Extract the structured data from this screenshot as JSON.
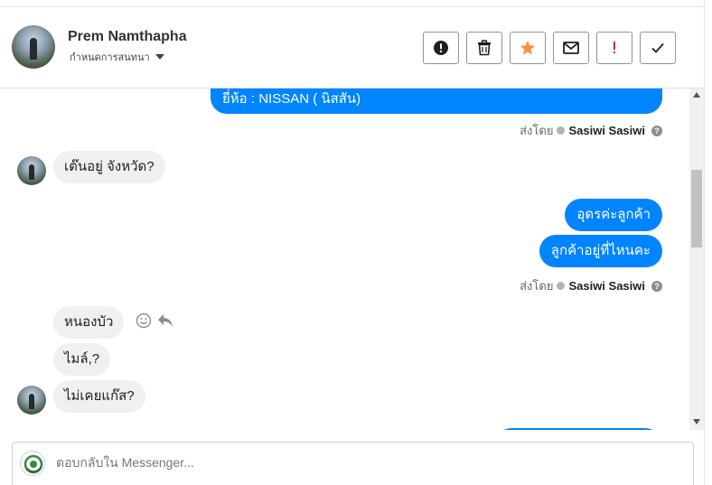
{
  "header": {
    "contact_name": "Prem Namthapha",
    "subtitle": "กำหนดการสนทนา"
  },
  "actions": [
    {
      "name": "report-spam-button",
      "icon": "exclamation-circle-icon"
    },
    {
      "name": "delete-button",
      "icon": "trash-icon"
    },
    {
      "name": "star-button",
      "icon": "star-icon"
    },
    {
      "name": "mark-unread-button",
      "icon": "envelope-icon"
    },
    {
      "name": "important-button",
      "icon": "exclamation-icon"
    },
    {
      "name": "mark-done-button",
      "icon": "checkmark-icon"
    }
  ],
  "messages": [
    {
      "direction": "out",
      "text": "ยี่ห้อ : NISSAN ( นิสสัน)"
    },
    {
      "direction": "meta",
      "prefix": "ส่งโดย",
      "sender": "Sasiwi Sasiwi"
    },
    {
      "direction": "in",
      "text": "เต๊นอยู่ จังหวัด?"
    },
    {
      "direction": "out",
      "text": "อุดรค่ะลูกค้า"
    },
    {
      "direction": "out",
      "text": "ลูกค้าอยู่ที่ไหนคะ"
    },
    {
      "direction": "meta",
      "prefix": "ส่งโดย",
      "sender": "Sasiwi Sasiwi"
    },
    {
      "direction": "in",
      "text": "หนองบัว"
    },
    {
      "direction": "in",
      "text": "ไมล์,?"
    },
    {
      "direction": "in",
      "text": "ไม่เคยแก๊ส?"
    }
  ],
  "composer": {
    "placeholder": "ตอบกลับใน Messenger..."
  },
  "colors": {
    "outgoing_bubble": "#0084ff",
    "incoming_bubble": "#f1f0f0",
    "star": "#f7923b",
    "important": "#e02020"
  }
}
